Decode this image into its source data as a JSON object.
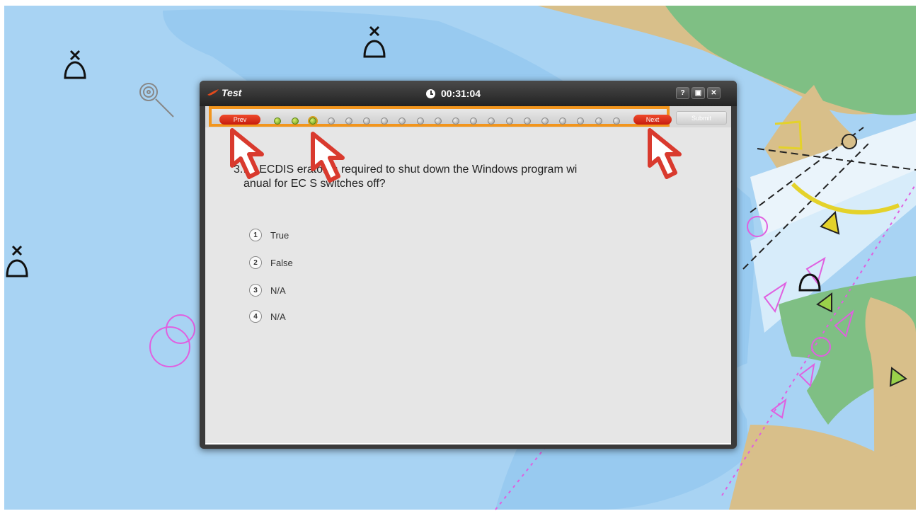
{
  "window": {
    "title": "Test",
    "timer": "00:31:04",
    "help_label": "?",
    "restore_label": "▣",
    "close_label": "✕"
  },
  "navigation": {
    "prev_label": "Prev",
    "next_label": "Next",
    "submit_label": "Submit",
    "total_questions": 20,
    "answered_questions": [
      1,
      2
    ],
    "current_question": 3
  },
  "question": {
    "number": "3.",
    "text": "The ECDIS operator is required to shut down the Windows program when the manual for ECDIS switches off?",
    "visible_line1": "he ECDIS  erator is required to shut down the Windows program wi",
    "visible_line2": "anual for EC  S switches off?"
  },
  "options": [
    {
      "index": "1",
      "label": "True"
    },
    {
      "index": "2",
      "label": "False"
    },
    {
      "index": "3",
      "label": "N/A"
    },
    {
      "index": "4",
      "label": "N/A"
    }
  ],
  "colors": {
    "accent_highlight": "#f2951d",
    "nav_button": "#d9301a",
    "answered_dot": "#8bbf2a",
    "pointer_red": "#d93a2e",
    "sea": "#a8d3f3",
    "land": "#d8bf8a",
    "vegetation": "#7fbf84"
  },
  "icons": {
    "title": "flame-icon",
    "timer": "clock-icon",
    "pointer": "cursor-arrow-icon"
  }
}
